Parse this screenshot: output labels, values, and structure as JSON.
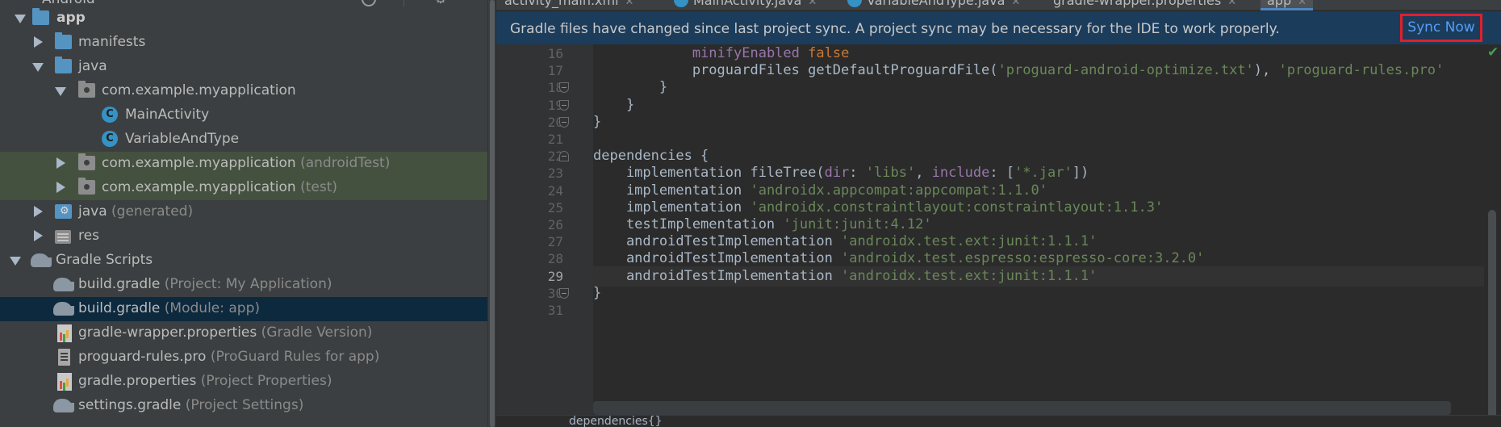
{
  "project": {
    "view_label": "Android",
    "tree": [
      {
        "label": "app",
        "sub": "",
        "icon": "folder-app-icon",
        "bold": true
      },
      {
        "label": "manifests",
        "sub": "",
        "icon": "folder-icon"
      },
      {
        "label": "java",
        "sub": "",
        "icon": "folder-icon"
      },
      {
        "label": "com.example.myapplication",
        "sub": "",
        "icon": "package-icon"
      },
      {
        "label": "MainActivity",
        "sub": "",
        "icon": "class-icon"
      },
      {
        "label": "VariableAndType",
        "sub": "",
        "icon": "class-icon"
      },
      {
        "label": "com.example.myapplication",
        "sub": "(androidTest)",
        "icon": "package-icon"
      },
      {
        "label": "com.example.myapplication",
        "sub": "(test)",
        "icon": "package-icon"
      },
      {
        "label": "java",
        "sub": "(generated)",
        "icon": "generated-folder-icon"
      },
      {
        "label": "res",
        "sub": "",
        "icon": "res-folder-icon"
      },
      {
        "label": "Gradle Scripts",
        "sub": "",
        "icon": "gradle-icon"
      },
      {
        "label": "build.gradle",
        "sub": "(Project: My Application)",
        "icon": "gradle-icon"
      },
      {
        "label": "build.gradle",
        "sub": "(Module: app)",
        "icon": "gradle-icon"
      },
      {
        "label": "gradle-wrapper.properties",
        "sub": "(Gradle Version)",
        "icon": "properties-icon"
      },
      {
        "label": "proguard-rules.pro",
        "sub": "(ProGuard Rules for app)",
        "icon": "text-file-icon"
      },
      {
        "label": "gradle.properties",
        "sub": "(Project Properties)",
        "icon": "properties-icon"
      },
      {
        "label": "settings.gradle",
        "sub": "(Project Settings)",
        "icon": "gradle-icon"
      }
    ]
  },
  "editor": {
    "tabs": [
      {
        "label": "activity_main.xml"
      },
      {
        "label": "MainActivity.java"
      },
      {
        "label": "VariableAndType.java"
      },
      {
        "label": "gradle-wrapper.properties"
      },
      {
        "label": "app"
      }
    ],
    "banner": {
      "message": "Gradle files have changed since last project sync. A project sync may be necessary for the IDE to work properly.",
      "action": "Sync Now"
    },
    "current_line": 29,
    "lines": [
      {
        "n": "16",
        "tokens": [
          [
            "            ",
            "nm"
          ],
          [
            "minifyEnabled",
            "pm"
          ],
          [
            " ",
            "nm"
          ],
          [
            "false",
            "kw"
          ]
        ]
      },
      {
        "n": "17",
        "tokens": [
          [
            "            proguardFiles getDefaultProguardFile(",
            "nm"
          ],
          [
            "'proguard-android-optimize.txt'",
            "str"
          ],
          [
            "), ",
            "nm"
          ],
          [
            "'proguard-rules.pro'",
            "str"
          ]
        ]
      },
      {
        "n": "18",
        "tokens": [
          [
            "        }",
            "nm"
          ]
        ]
      },
      {
        "n": "19",
        "tokens": [
          [
            "    }",
            "nm"
          ]
        ]
      },
      {
        "n": "20",
        "tokens": [
          [
            "}",
            "nm"
          ]
        ]
      },
      {
        "n": "21",
        "tokens": []
      },
      {
        "n": "22",
        "tokens": [
          [
            "dependencies {",
            "nm"
          ]
        ]
      },
      {
        "n": "23",
        "tokens": [
          [
            "    implementation fileTree(",
            "nm"
          ],
          [
            "dir",
            "pm"
          ],
          [
            ": ",
            "nm"
          ],
          [
            "'libs'",
            "str"
          ],
          [
            ", ",
            "nm"
          ],
          [
            "include",
            "pm"
          ],
          [
            ": [",
            "nm"
          ],
          [
            "'*.jar'",
            "str"
          ],
          [
            "])",
            "nm"
          ]
        ]
      },
      {
        "n": "24",
        "tokens": [
          [
            "    implementation ",
            "nm"
          ],
          [
            "'androidx.appcompat:appcompat:1.1.0'",
            "str"
          ]
        ]
      },
      {
        "n": "25",
        "tokens": [
          [
            "    implementation ",
            "nm"
          ],
          [
            "'androidx.constraintlayout:constraintlayout:1.1.3'",
            "str"
          ]
        ]
      },
      {
        "n": "26",
        "tokens": [
          [
            "    testImplementation ",
            "nm"
          ],
          [
            "'junit:junit:4.12'",
            "str"
          ]
        ]
      },
      {
        "n": "27",
        "tokens": [
          [
            "    androidTestImplementation ",
            "nm"
          ],
          [
            "'androidx.test.ext:junit:1.1.1'",
            "str"
          ]
        ]
      },
      {
        "n": "28",
        "tokens": [
          [
            "    androidTestImplementation ",
            "nm"
          ],
          [
            "'androidx.test.espresso:espresso-core:3.2.0'",
            "str"
          ]
        ]
      },
      {
        "n": "29",
        "tokens": [
          [
            "    androidTestImplementation ",
            "nm"
          ],
          [
            "'androidx.test.ext:junit:1.1.1'",
            "str"
          ]
        ]
      },
      {
        "n": "30",
        "tokens": [
          [
            "}",
            "nm"
          ]
        ]
      },
      {
        "n": "31",
        "tokens": []
      }
    ],
    "breadcrumb": "dependencies{}"
  },
  "colors": {
    "banner_bg": "#1c3c5b",
    "sync_highlight": "#e0202b",
    "link": "#589df6",
    "selected_row": "#0d293e",
    "test_row": "#45513f"
  }
}
